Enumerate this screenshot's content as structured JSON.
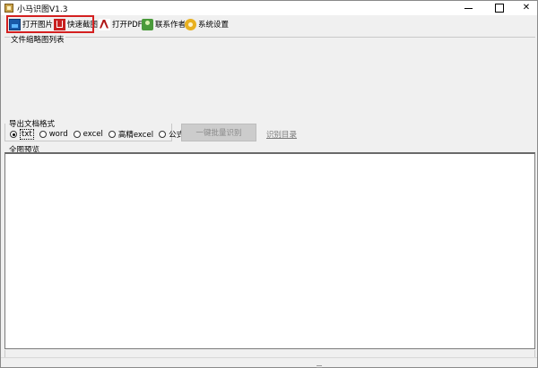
{
  "window": {
    "title": "小马识图V1.3",
    "icon": "app-icon"
  },
  "toolbar": {
    "items": [
      {
        "label": "打开图片",
        "icon": "image-icon"
      },
      {
        "label": "快速截图",
        "icon": "screenshot-icon"
      },
      {
        "label": "打开PDF",
        "icon": "pdf-icon"
      },
      {
        "label": "联系作者",
        "icon": "contact-icon"
      },
      {
        "label": "系统设置",
        "icon": "settings-icon"
      }
    ]
  },
  "thumbnails": {
    "label": "文件缩略图列表"
  },
  "export": {
    "label": "导出文档格式",
    "options": [
      {
        "label": "txt",
        "checked": true
      },
      {
        "label": "word",
        "checked": false
      },
      {
        "label": "excel",
        "checked": false
      },
      {
        "label": "高精excel",
        "checked": false
      },
      {
        "label": "公式",
        "checked": false
      }
    ]
  },
  "batch": {
    "button_label": "一键批量识别"
  },
  "directory": {
    "link_label": "识别目录"
  },
  "preview": {
    "label": "全图预览"
  },
  "colors": {
    "highlight": "#d42020",
    "background": "#f0f0f0"
  }
}
